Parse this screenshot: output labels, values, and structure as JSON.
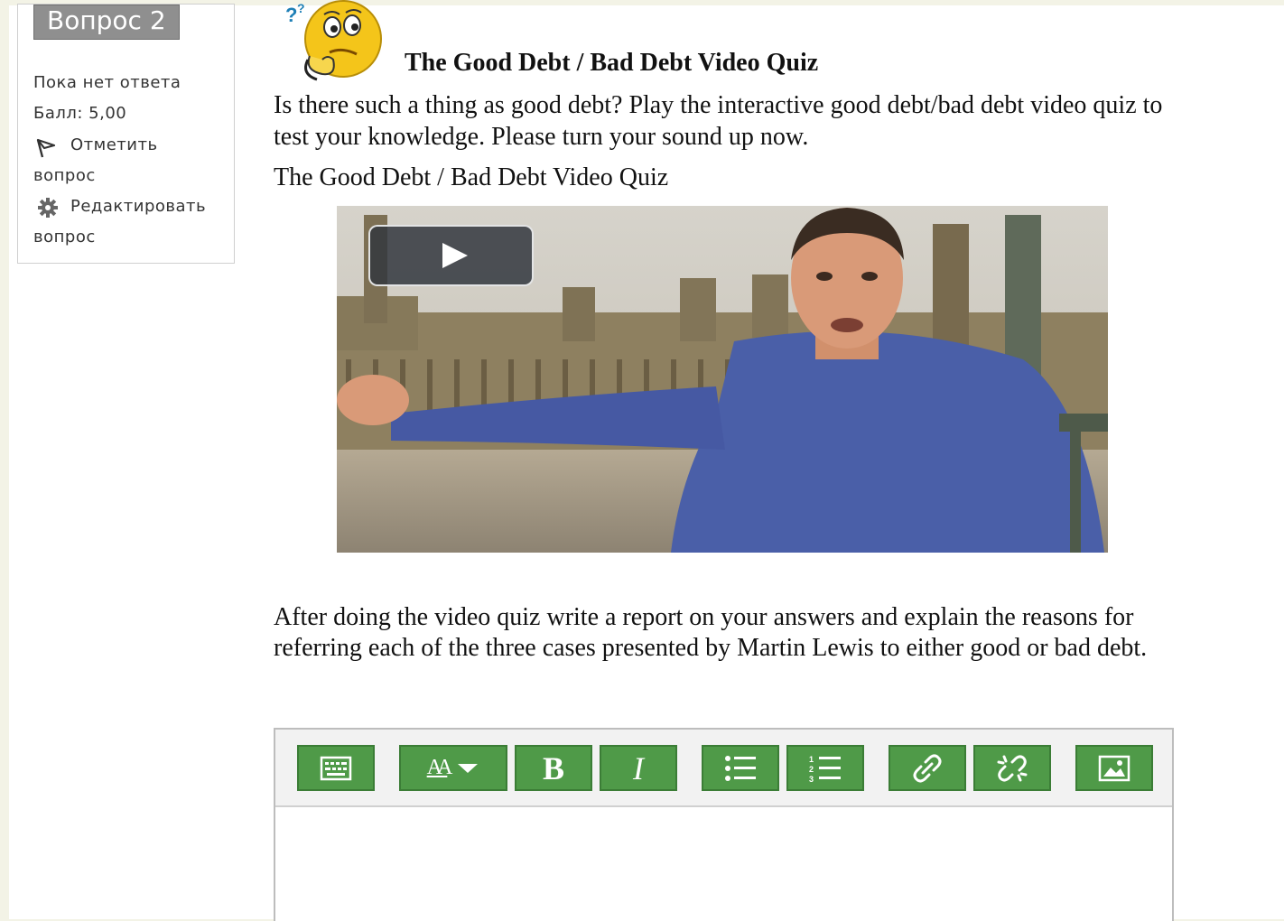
{
  "sidebar": {
    "question_label": "Вопрос 2",
    "status": "Пока нет ответа",
    "score": "Балл: 5,00",
    "flag_label_line1": "Отметить",
    "flag_label_line2": "вопрос",
    "edit_label_line1": "Редактировать",
    "edit_label_line2": "вопрос"
  },
  "quiz": {
    "title": "The Good Debt / Bad Debt Video Quiz",
    "intro": "Is there such a thing as good debt? Play the interactive good debt/bad debt video quiz to test your knowledge. Please turn your sound up now.",
    "video_link": "The Good Debt / Bad Debt Video Quiz",
    "instructions": "After doing the video quiz write a report on your answers and explain the reasons for referring each of the three cases presented by Martin Lewis to either good or bad debt."
  },
  "editor": {
    "buttons": {
      "toolbar_toggle": "keyboard-icon",
      "font_size": "font-size-icon",
      "bold": "B",
      "italic": "I",
      "unordered_list": "bulleted-list-icon",
      "ordered_list": "numbered-list-icon",
      "link": "link-icon",
      "unlink": "unlink-icon",
      "image": "image-icon"
    },
    "font_size_glyph": "AA"
  },
  "colors": {
    "toolbar_button": "#4f9a48",
    "badge": "#8f8f8f"
  }
}
